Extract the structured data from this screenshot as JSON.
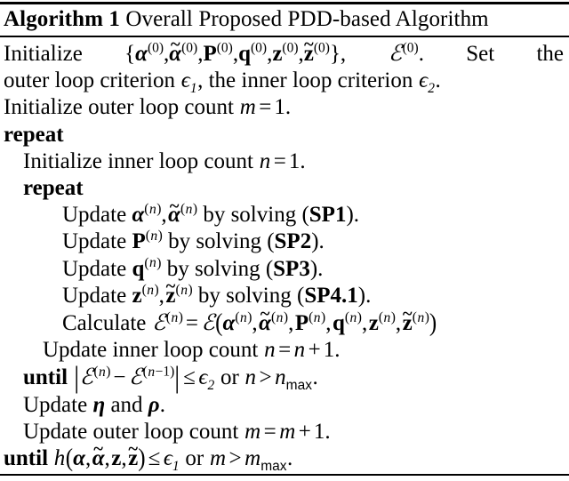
{
  "header": {
    "keyword": "Algorithm 1",
    "title": "Overall Proposed PDD-based Algorithm",
    "full_title": "Algorithm 1 Overall Proposed PDD-based Algorithm"
  },
  "lines": {
    "init_vars": {
      "text": "Initialize {α(0), α̃(0), P(0), q(0), z(0), z̃(0)}, ℰ(0). Set the",
      "lead": "Initialize",
      "tail": ". Set the"
    },
    "init_criteria": {
      "text": "outer loop criterion ϵ1, the inner loop criterion ϵ2.",
      "pre": "outer loop criterion",
      "mid": ", the inner loop criterion",
      "post": "."
    },
    "init_outer": {
      "text": "Initialize outer loop count m = 1.",
      "pre": "Initialize outer loop count",
      "var": "m",
      "eq": "=",
      "val": "1."
    },
    "repeat_outer": {
      "text": "repeat"
    },
    "init_inner": {
      "text": "Initialize inner loop count n = 1.",
      "pre": "Initialize inner loop count",
      "var": "n",
      "eq": "=",
      "val": "1."
    },
    "repeat_inner": {
      "text": "repeat"
    },
    "update_alpha": {
      "text": "Update α(n), α̃(n) by solving (SP1).",
      "pre": "Update",
      "mid": "by solving",
      "label": "SP1",
      "post": "."
    },
    "update_P": {
      "text": "Update P(n) by solving (SP2).",
      "pre": "Update",
      "mid": "by solving",
      "label": "SP2",
      "post": "."
    },
    "update_q": {
      "text": "Update q(n) by solving (SP3).",
      "pre": "Update",
      "mid": "by solving",
      "label": "SP3",
      "post": "."
    },
    "update_z": {
      "text": "Update z(n), z̃(n) by solving (SP4.1).",
      "pre": "Update",
      "mid": "by solving",
      "label": "SP4.1",
      "post": "."
    },
    "calculate_E": {
      "text": "Calculate ℰ(n) = ℰ(α(n), α̃(n), P(n), q(n), z(n), z̃(n))",
      "pre": "Calculate",
      "eq": "="
    },
    "update_inner_count": {
      "text": "Update inner loop count n = n + 1.",
      "pre": "Update inner loop count",
      "var": "n",
      "eq": "=",
      "plus": "+",
      "one": "1."
    },
    "until_inner": {
      "text": "until |ℰ(n) − ℰ(n−1)| ≤ ϵ2 or n > nmax.",
      "keyword": "until",
      "minus": "−",
      "leq": "≤",
      "or": "or",
      "gt": ">",
      "maxsub": "max",
      "period": "."
    },
    "update_eta_rho": {
      "text": "Update η and ρ.",
      "pre": "Update",
      "and": "and",
      "post": "."
    },
    "update_outer_count": {
      "text": "Update outer loop count m = m + 1.",
      "pre": "Update outer loop count",
      "var": "m",
      "eq": "=",
      "plus": "+",
      "one": "1."
    },
    "until_outer": {
      "text": "until h(α, α̃, z, z̃) ≤ ϵ1 or m > mmax.",
      "keyword": "until",
      "func": "h",
      "leq": "≤",
      "or": "or",
      "gt": ">",
      "maxsub": "max",
      "period": "."
    }
  },
  "symbols": {
    "alpha": "α",
    "epsilon": "ϵ",
    "eta": "η",
    "rho": "ρ",
    "script_E": "ℰ",
    "tilde": "~",
    "P": "P",
    "q": "q",
    "z": "z",
    "m": "m",
    "n": "n",
    "zero": "0",
    "one": "1",
    "n_minus_1": "n−1",
    "lbrace": "{",
    "rbrace": "}",
    "lparen": "(",
    "rparen": ")",
    "comma": ","
  },
  "colors": {
    "text": "#000000",
    "background": "#ffffff",
    "rule": "#000000"
  }
}
